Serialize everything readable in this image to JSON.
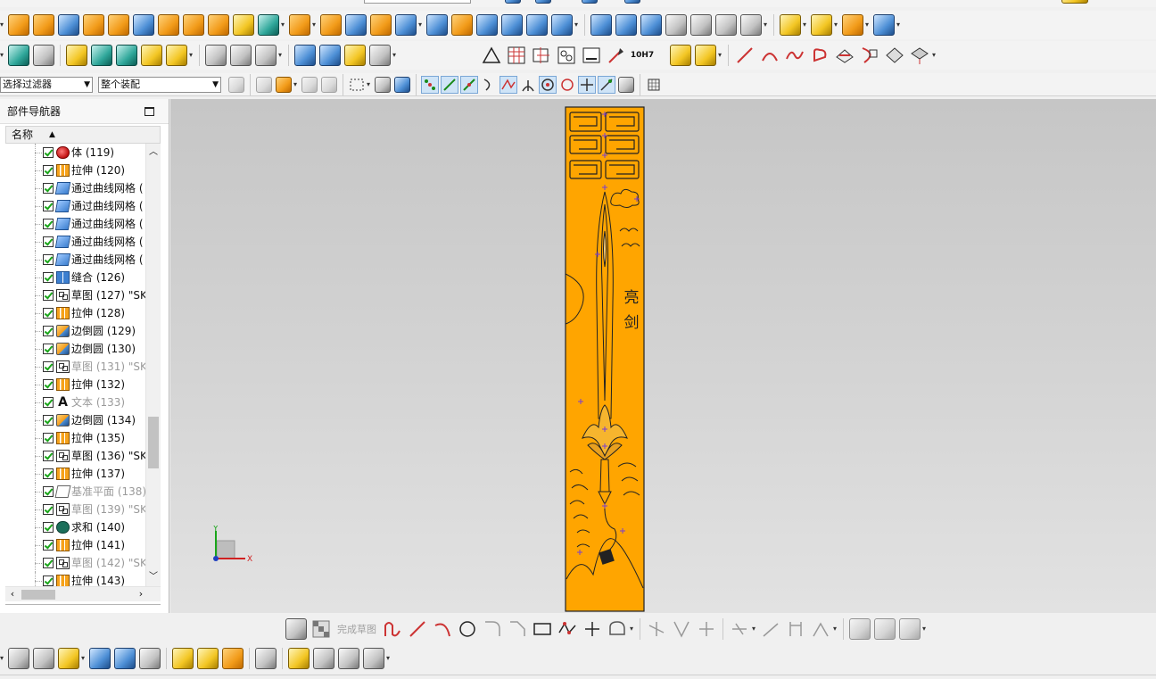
{
  "selection_bar": {
    "filter": "选择过滤器",
    "assembly_scope": "整个装配"
  },
  "part_navigator": {
    "title": "部件导航器",
    "column_header": "名称",
    "features": [
      {
        "label": "体 (119)",
        "type": "body",
        "dim": false
      },
      {
        "label": "拉伸 (120)",
        "type": "extrude",
        "dim": false
      },
      {
        "label": "通过曲线网格 (",
        "type": "mesh",
        "dim": false
      },
      {
        "label": "通过曲线网格 (",
        "type": "mesh",
        "dim": false
      },
      {
        "label": "通过曲线网格 (",
        "type": "mesh",
        "dim": false
      },
      {
        "label": "通过曲线网格 (",
        "type": "mesh",
        "dim": false
      },
      {
        "label": "通过曲线网格 (",
        "type": "mesh",
        "dim": false
      },
      {
        "label": "缝合 (126)",
        "type": "sew",
        "dim": false
      },
      {
        "label": "草图 (127) \"SK",
        "type": "sketch",
        "dim": false
      },
      {
        "label": "拉伸 (128)",
        "type": "extrude",
        "dim": false
      },
      {
        "label": "边倒圆 (129)",
        "type": "blend",
        "dim": false
      },
      {
        "label": "边倒圆 (130)",
        "type": "blend",
        "dim": false
      },
      {
        "label": "草图 (131) \"SK",
        "type": "sketch",
        "dim": true
      },
      {
        "label": "拉伸 (132)",
        "type": "extrude",
        "dim": false
      },
      {
        "label": "文本 (133)",
        "type": "text",
        "dim": true
      },
      {
        "label": "边倒圆 (134)",
        "type": "blend",
        "dim": false
      },
      {
        "label": "拉伸 (135)",
        "type": "extrude",
        "dim": false
      },
      {
        "label": "草图 (136) \"SK",
        "type": "sketch",
        "dim": false
      },
      {
        "label": "拉伸 (137)",
        "type": "extrude",
        "dim": false
      },
      {
        "label": "基准平面 (138)",
        "type": "plane",
        "dim": true
      },
      {
        "label": "草图 (139) \"SK",
        "type": "sketch",
        "dim": true
      },
      {
        "label": "求和 (140)",
        "type": "unite",
        "dim": false
      },
      {
        "label": "拉伸 (141)",
        "type": "extrude",
        "dim": false
      },
      {
        "label": "草图 (142) \"SK",
        "type": "sketch",
        "dim": true
      },
      {
        "label": "拉伸 (143)",
        "type": "extrude",
        "dim": false
      }
    ]
  },
  "model": {
    "engraved_text": [
      "亮",
      "剑"
    ],
    "fill_color": "#ffa500",
    "stroke_color": "#222222"
  },
  "triad": {
    "x_label": "X",
    "y_label": "Y"
  },
  "sketch_toolbar": {
    "finish_sketch": "完成草图",
    "constraint_label": "10H7"
  }
}
